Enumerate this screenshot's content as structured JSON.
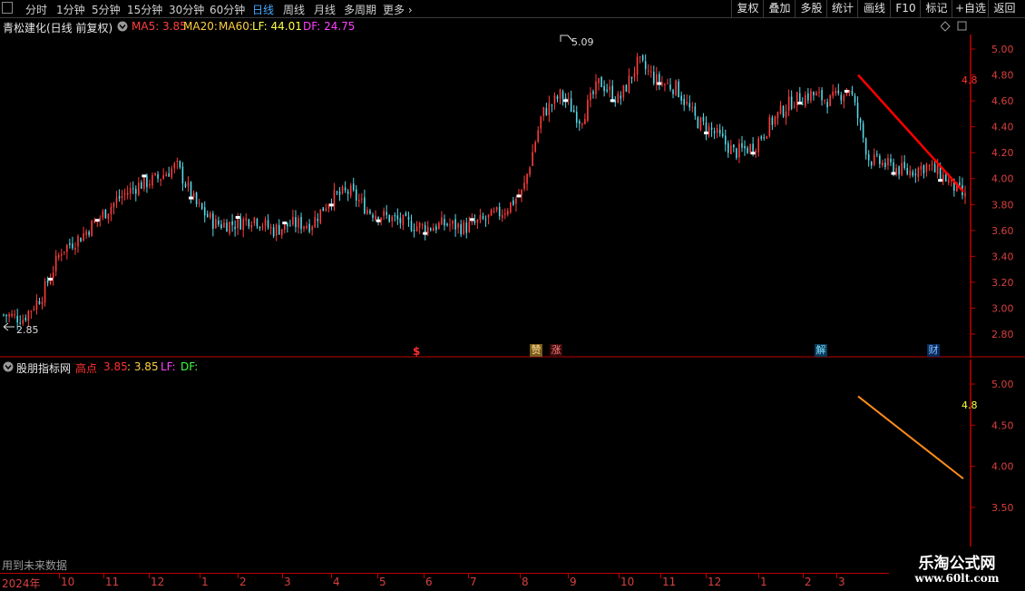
{
  "toolbar": {
    "periods": [
      "分时",
      "1分钟",
      "5分钟",
      "15分钟",
      "30分钟",
      "60分钟",
      "日线",
      "周线",
      "月线",
      "多周期",
      "更多"
    ],
    "active_period": "日线",
    "right_buttons": [
      "复权",
      "叠加",
      "多股",
      "统计",
      "画线",
      "F10",
      "标记",
      "+自选",
      "返回"
    ]
  },
  "main_header": {
    "stock_title": "青松建化(日线 前复权)",
    "ma5_label": "MA5: 3.85",
    "ma20_label": "MA20:",
    "ma60_label": "MA60:",
    "lf_label": "LF: 44.01",
    "df_label": "DF: 24.75"
  },
  "main_chart": {
    "high_label": "5.09",
    "low_label": "2.85",
    "y_ticks": [
      "5.00",
      "4.80",
      "4.60",
      "4.40",
      "4.20",
      "4.00",
      "3.80",
      "3.60",
      "3.40",
      "3.20",
      "3.00",
      "2.80"
    ],
    "right_edge_label": "4.8",
    "event_markers": [
      "$",
      "赞",
      "涨",
      "解",
      "财"
    ]
  },
  "sub_header": {
    "indicator_name": "股朋指标网",
    "gaodian_label": "高点",
    "gaodian_value": "3.85",
    "second_value": ": 3.85",
    "lf_label": "LF:",
    "df_label": "DF:"
  },
  "sub_chart": {
    "y_ticks": [
      "5.00",
      "4.50",
      "4.00",
      "3.50"
    ],
    "right_edge_label": "4.8",
    "footer_note": "用到未来数据"
  },
  "x_axis": {
    "year_label": "2024年",
    "month_labels": [
      "10",
      "11",
      "12",
      "1",
      "2",
      "3",
      "4",
      "5",
      "6",
      "7",
      "8",
      "9",
      "10",
      "11",
      "12",
      "1",
      "2",
      "3"
    ]
  },
  "watermark": {
    "title": "乐淘公式网",
    "url": "www.60lt.com"
  },
  "colors": {
    "up": "#ff3c3c",
    "down": "#56d8e8",
    "trend_line": "#ff0000",
    "sub_line": "#ff8c1a",
    "ma5": "#ff4040",
    "ma20": "#ffd040",
    "lf": "#ffff40",
    "df": "#ff40ff"
  },
  "chart_data": {
    "type": "candlestick",
    "high": 5.09,
    "low": 2.85,
    "ylim": [
      2.75,
      5.15
    ],
    "approx_close_path": [
      2.95,
      2.92,
      3.1,
      3.45,
      3.55,
      3.7,
      3.85,
      3.95,
      4.0,
      4.1,
      3.8,
      3.65,
      3.65,
      3.7,
      3.6,
      3.65,
      3.65,
      3.85,
      3.9,
      3.75,
      3.7,
      3.65,
      3.62,
      3.65,
      3.62,
      3.68,
      3.75,
      3.9,
      4.5,
      4.65,
      4.45,
      4.75,
      4.6,
      4.9,
      4.75,
      4.7,
      4.45,
      4.35,
      4.2,
      4.25,
      4.45,
      4.6,
      4.65,
      4.6,
      4.7,
      4.15,
      4.1,
      4.05,
      4.1,
      4.0,
      3.85
    ],
    "trend_line_main": {
      "start": 4.8,
      "end": 3.9
    },
    "sub_line": {
      "start": 4.85,
      "end": 3.85,
      "ylim": [
        3.0,
        5.4
      ]
    }
  }
}
